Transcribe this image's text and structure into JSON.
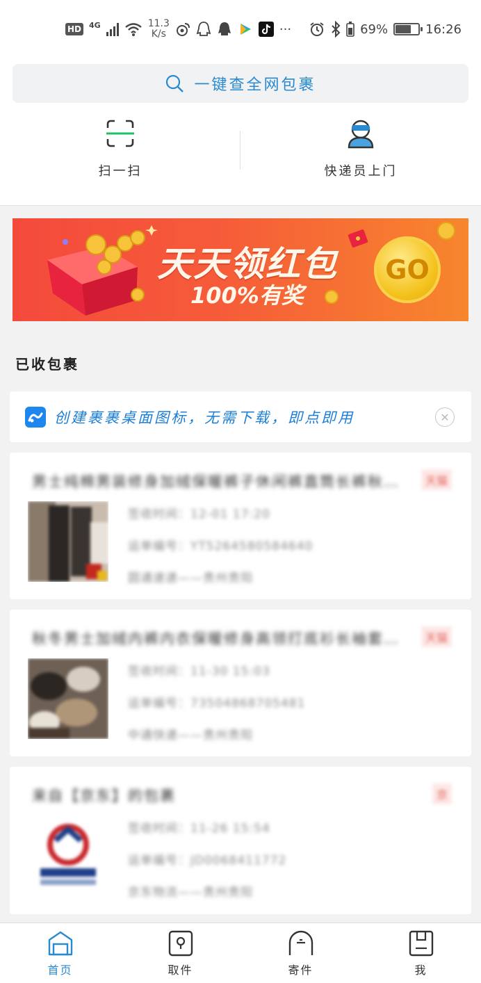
{
  "status_bar": {
    "hd": "HD",
    "network": "4G",
    "speed_value": "11.3",
    "speed_unit": "K/s",
    "more": "···",
    "battery_percent": "69%",
    "battery_level": 0.69,
    "time": "16:26"
  },
  "search": {
    "placeholder": "一键查全网包裹"
  },
  "quick_actions": {
    "scan_label": "扫一扫",
    "courier_label": "快递员上门"
  },
  "banner": {
    "title": "天天领红包",
    "subtitle": "100%有奖",
    "go": "GO"
  },
  "received": {
    "title": "已收包裹",
    "tip_text": "创建裹裹桌面图标，无需下载，即点即用",
    "close": "✕"
  },
  "packages": [
    {
      "title": "男士纯棉男装修身加绒保暖裤子休闲裤直筒长裤秋冬款…",
      "badge": "天猫",
      "line1": "签收时间：12-01 17:20",
      "line2": "运单编号：YT5264580584640",
      "line3": "圆通速递——贵州贵阳"
    },
    {
      "title": "秋冬男士加绒内裤内衣保暖修身高领打底衫长袖套装加…",
      "badge": "天猫",
      "line1": "签收时间：11-30 15:03",
      "line2": "运单编号：73504868705481",
      "line3": "中通快递——贵州贵阳"
    },
    {
      "title": "来自【京东】的包裹",
      "badge": "京",
      "line1": "签收时间：11-26 15:54",
      "line2": "运单编号：JD0068411772",
      "line3": "京东物流——贵州贵阳"
    }
  ],
  "bottom_nav": [
    {
      "label": "首页",
      "active": true
    },
    {
      "label": "取件",
      "active": false
    },
    {
      "label": "寄件",
      "active": false
    },
    {
      "label": "我",
      "active": false
    }
  ],
  "colors": {
    "accent": "#2a8ad0",
    "banner_start": "#f44a3c",
    "banner_end": "#f7862d"
  }
}
